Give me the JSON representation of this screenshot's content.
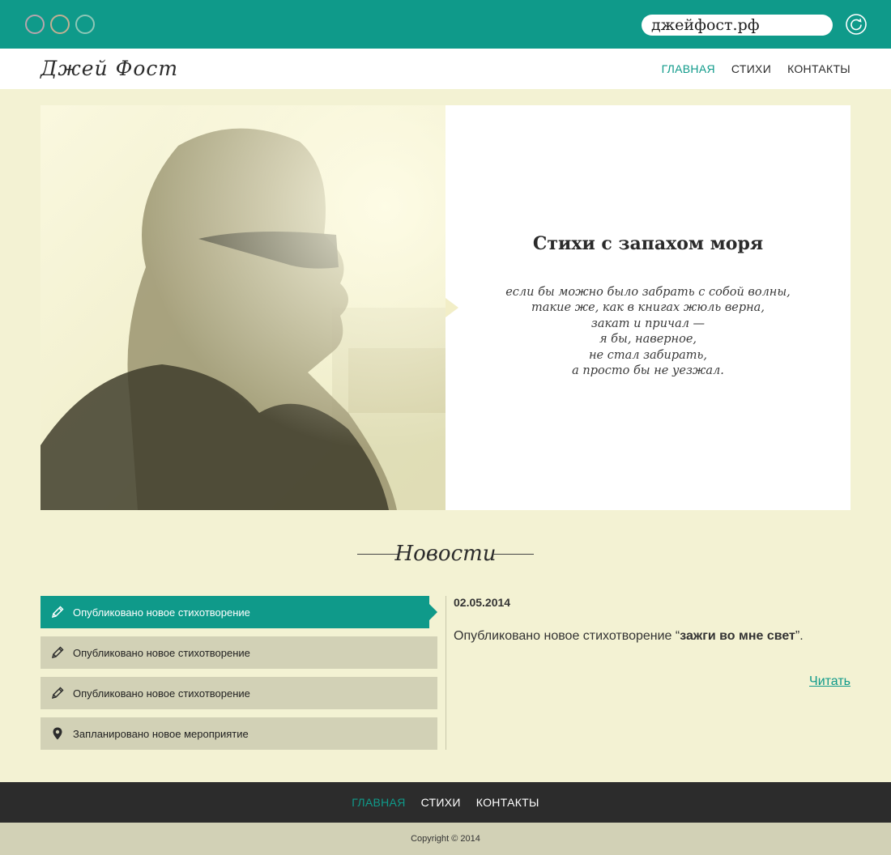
{
  "browser": {
    "address": "джейфост.рф",
    "icons": [
      "circle-button",
      "circle-button",
      "circle-button",
      "reload-icon"
    ]
  },
  "header": {
    "logo": "Джей Фост",
    "nav": [
      {
        "label": "ГЛАВНАЯ",
        "active": true
      },
      {
        "label": "СТИХИ",
        "active": false
      },
      {
        "label": "КОНТАКТЫ",
        "active": false
      }
    ]
  },
  "hero": {
    "title": "Стихи с запахом моря",
    "poem_lines": [
      "если бы можно было забрать с собой волны,",
      "такие же, как в книгах жюль верна,",
      "закат и причал —",
      "я бы, наверное,",
      "не стал забирать,",
      "а просто бы не уезжал."
    ]
  },
  "news": {
    "heading": "Новости",
    "items": [
      {
        "label": "Опубликовано новое стихотворение",
        "icon": "pencil-icon",
        "active": true
      },
      {
        "label": "Опубликовано новое стихотворение",
        "icon": "pencil-icon",
        "active": false
      },
      {
        "label": "Опубликовано новое стихотворение",
        "icon": "pencil-icon",
        "active": false
      },
      {
        "label": "Запланировано новое мероприятие",
        "icon": "map-pin-icon",
        "active": false
      }
    ],
    "detail": {
      "date": "02.05.2014",
      "text_prefix": "Опубликовано новое стихотворение “",
      "text_bold": "зажги во мне свет",
      "text_suffix": "”.",
      "read_link": "Читать"
    }
  },
  "footer": {
    "nav": [
      {
        "label": "ГЛАВНАЯ",
        "active": true
      },
      {
        "label": "СТИХИ",
        "active": false
      },
      {
        "label": "КОНТАКТЫ",
        "active": false
      }
    ],
    "copyright": "Copyright © 2014"
  },
  "colors": {
    "accent": "#0f9a8a",
    "page_bg": "#f3f2d3",
    "list_bg": "#d2d1b6",
    "footer_bg": "#2c2c2c"
  }
}
